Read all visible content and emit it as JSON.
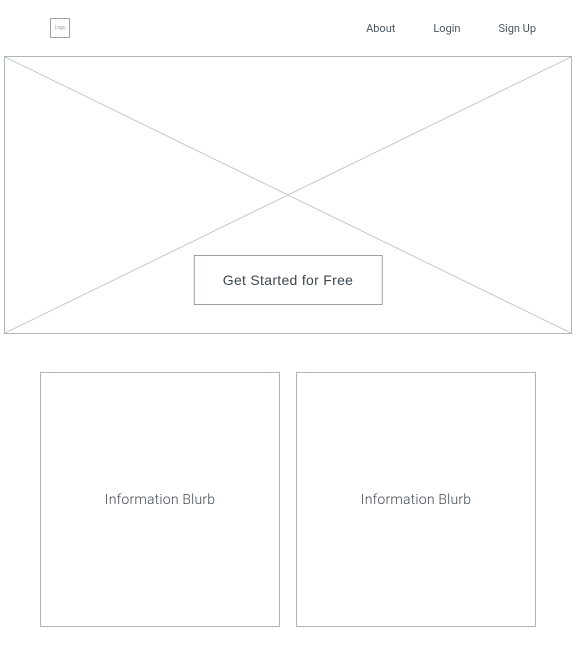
{
  "header": {
    "logo_label": "Logo",
    "nav": {
      "about": "About",
      "login": "Login",
      "signup": "Sign Up"
    }
  },
  "hero": {
    "cta_label": "Get Started for Free"
  },
  "cards": [
    {
      "label": "Information Blurb"
    },
    {
      "label": "Information Blurb"
    }
  ]
}
